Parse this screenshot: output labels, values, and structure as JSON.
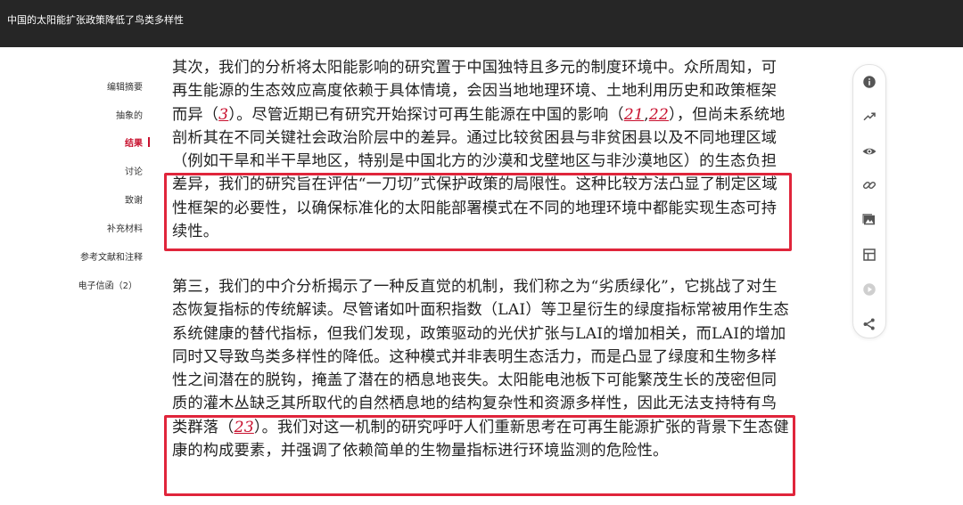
{
  "topbar": {
    "title": "中国的太阳能扩张政策降低了鸟类多样性"
  },
  "toc": {
    "items": [
      {
        "label": "编辑摘要"
      },
      {
        "label": "抽象的"
      },
      {
        "label": "结果"
      },
      {
        "label": "讨论"
      },
      {
        "label": "致谢"
      },
      {
        "label": "补充材料"
      },
      {
        "label": "参考文献和注释"
      },
      {
        "label": "电子信函（2）"
      }
    ],
    "active_index": 2
  },
  "article": {
    "para1": {
      "t1": "其次，我们的分析将太阳能影响的研究置于中国独特且多元的制度环境中。众所周知，可再生能源的生态效应高度依赖于具体情境，会因当地地理环境、土地利用历史和政策框架而异（",
      "c1": "3",
      "t2": "）。尽管近期已有研究开始探讨可再生能源在中国的影响（",
      "c2": "21",
      "t3": ",",
      "c3": "22",
      "t4": "），但尚未系统地剖析其在不同关键社会政治阶层中的差异。通过比较贫困县与非贫困县以及不同地理区域（例如干旱和半干旱地区，特别是中国北方的沙漠和戈壁地区与非沙漠地区）的生态负担差异，我们的研究旨在评估“一刀切”式保护政策的局限性。这种比较方法凸显了制定区域性框架的必要性，以确保标准化的太阳能部署模式在不同的地理环境中都能实现生态可持续性。"
    },
    "para2": {
      "t1": "第三，我们的中介分析揭示了一种反直觉的机制，我们称之为“劣质绿化”，它挑战了对生态恢复指标的传统解读。尽管诸如叶面积指数（LAI）等卫星衍生的绿度指标常被用作生态系统健康的替代指标，但我们发现，政策驱动的光伏扩张与LAI的增加相关，而LAI的增加同时又导致鸟类多样性的降低。这种模式并非表明生态活力，而是凸显了绿度和生物多样性之间潜在的脱钩，掩盖了潜在的栖息地丧失。太阳能电池板下可能繁茂生长的茂密但同质的灌木丛缺乏其所取代的自然栖息地的结构复杂性和资源多样性，因此无法支持特有鸟类群落（",
      "c1": "23",
      "t2": "）。我们对这一机制的研究呼吁人们重新思考在可再生能源扩张的背景下生态健康的构成要素，并强调了依赖简单的生物量指标进行环境监测的危险性。"
    }
  },
  "rail": {
    "icons": [
      "info-icon",
      "trending-up-icon",
      "eye-icon",
      "link-icon",
      "image-icon",
      "table-icon",
      "play-icon",
      "share-icon"
    ]
  },
  "colors": {
    "topbar": "#262626",
    "accent": "#c8102e",
    "highlight": "#e0253b"
  }
}
